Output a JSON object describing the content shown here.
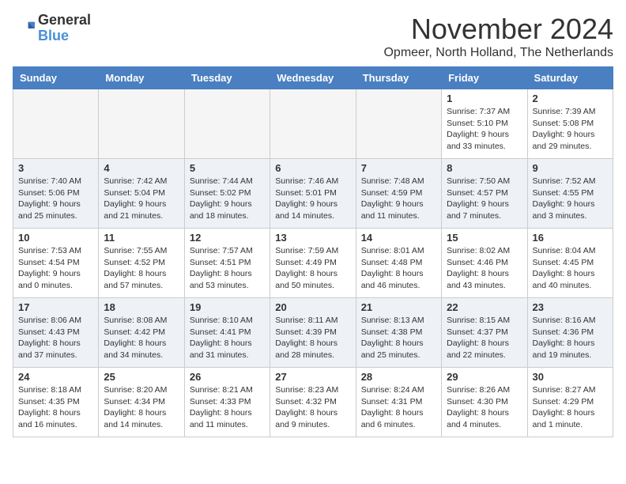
{
  "header": {
    "logo_line1": "General",
    "logo_line2": "Blue",
    "title": "November 2024",
    "subtitle": "Opmeer, North Holland, The Netherlands"
  },
  "weekdays": [
    "Sunday",
    "Monday",
    "Tuesday",
    "Wednesday",
    "Thursday",
    "Friday",
    "Saturday"
  ],
  "weeks": [
    [
      {
        "day": "",
        "info": ""
      },
      {
        "day": "",
        "info": ""
      },
      {
        "day": "",
        "info": ""
      },
      {
        "day": "",
        "info": ""
      },
      {
        "day": "",
        "info": ""
      },
      {
        "day": "1",
        "info": "Sunrise: 7:37 AM\nSunset: 5:10 PM\nDaylight: 9 hours and 33 minutes."
      },
      {
        "day": "2",
        "info": "Sunrise: 7:39 AM\nSunset: 5:08 PM\nDaylight: 9 hours and 29 minutes."
      }
    ],
    [
      {
        "day": "3",
        "info": "Sunrise: 7:40 AM\nSunset: 5:06 PM\nDaylight: 9 hours and 25 minutes."
      },
      {
        "day": "4",
        "info": "Sunrise: 7:42 AM\nSunset: 5:04 PM\nDaylight: 9 hours and 21 minutes."
      },
      {
        "day": "5",
        "info": "Sunrise: 7:44 AM\nSunset: 5:02 PM\nDaylight: 9 hours and 18 minutes."
      },
      {
        "day": "6",
        "info": "Sunrise: 7:46 AM\nSunset: 5:01 PM\nDaylight: 9 hours and 14 minutes."
      },
      {
        "day": "7",
        "info": "Sunrise: 7:48 AM\nSunset: 4:59 PM\nDaylight: 9 hours and 11 minutes."
      },
      {
        "day": "8",
        "info": "Sunrise: 7:50 AM\nSunset: 4:57 PM\nDaylight: 9 hours and 7 minutes."
      },
      {
        "day": "9",
        "info": "Sunrise: 7:52 AM\nSunset: 4:55 PM\nDaylight: 9 hours and 3 minutes."
      }
    ],
    [
      {
        "day": "10",
        "info": "Sunrise: 7:53 AM\nSunset: 4:54 PM\nDaylight: 9 hours and 0 minutes."
      },
      {
        "day": "11",
        "info": "Sunrise: 7:55 AM\nSunset: 4:52 PM\nDaylight: 8 hours and 57 minutes."
      },
      {
        "day": "12",
        "info": "Sunrise: 7:57 AM\nSunset: 4:51 PM\nDaylight: 8 hours and 53 minutes."
      },
      {
        "day": "13",
        "info": "Sunrise: 7:59 AM\nSunset: 4:49 PM\nDaylight: 8 hours and 50 minutes."
      },
      {
        "day": "14",
        "info": "Sunrise: 8:01 AM\nSunset: 4:48 PM\nDaylight: 8 hours and 46 minutes."
      },
      {
        "day": "15",
        "info": "Sunrise: 8:02 AM\nSunset: 4:46 PM\nDaylight: 8 hours and 43 minutes."
      },
      {
        "day": "16",
        "info": "Sunrise: 8:04 AM\nSunset: 4:45 PM\nDaylight: 8 hours and 40 minutes."
      }
    ],
    [
      {
        "day": "17",
        "info": "Sunrise: 8:06 AM\nSunset: 4:43 PM\nDaylight: 8 hours and 37 minutes."
      },
      {
        "day": "18",
        "info": "Sunrise: 8:08 AM\nSunset: 4:42 PM\nDaylight: 8 hours and 34 minutes."
      },
      {
        "day": "19",
        "info": "Sunrise: 8:10 AM\nSunset: 4:41 PM\nDaylight: 8 hours and 31 minutes."
      },
      {
        "day": "20",
        "info": "Sunrise: 8:11 AM\nSunset: 4:39 PM\nDaylight: 8 hours and 28 minutes."
      },
      {
        "day": "21",
        "info": "Sunrise: 8:13 AM\nSunset: 4:38 PM\nDaylight: 8 hours and 25 minutes."
      },
      {
        "day": "22",
        "info": "Sunrise: 8:15 AM\nSunset: 4:37 PM\nDaylight: 8 hours and 22 minutes."
      },
      {
        "day": "23",
        "info": "Sunrise: 8:16 AM\nSunset: 4:36 PM\nDaylight: 8 hours and 19 minutes."
      }
    ],
    [
      {
        "day": "24",
        "info": "Sunrise: 8:18 AM\nSunset: 4:35 PM\nDaylight: 8 hours and 16 minutes."
      },
      {
        "day": "25",
        "info": "Sunrise: 8:20 AM\nSunset: 4:34 PM\nDaylight: 8 hours and 14 minutes."
      },
      {
        "day": "26",
        "info": "Sunrise: 8:21 AM\nSunset: 4:33 PM\nDaylight: 8 hours and 11 minutes."
      },
      {
        "day": "27",
        "info": "Sunrise: 8:23 AM\nSunset: 4:32 PM\nDaylight: 8 hours and 9 minutes."
      },
      {
        "day": "28",
        "info": "Sunrise: 8:24 AM\nSunset: 4:31 PM\nDaylight: 8 hours and 6 minutes."
      },
      {
        "day": "29",
        "info": "Sunrise: 8:26 AM\nSunset: 4:30 PM\nDaylight: 8 hours and 4 minutes."
      },
      {
        "day": "30",
        "info": "Sunrise: 8:27 AM\nSunset: 4:29 PM\nDaylight: 8 hours and 1 minute."
      }
    ]
  ]
}
